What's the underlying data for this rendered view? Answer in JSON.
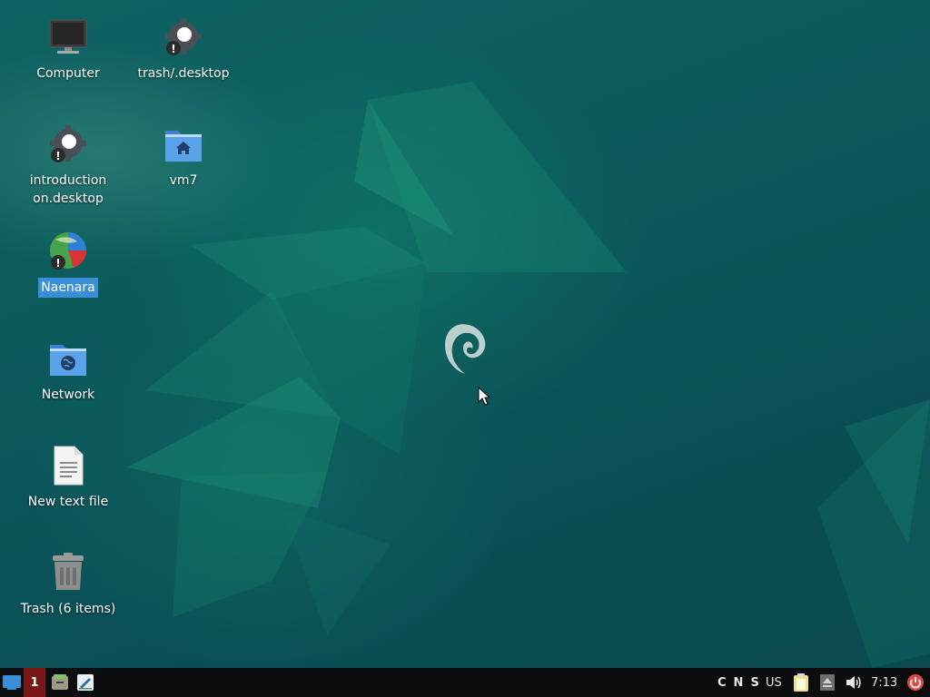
{
  "desktop": {
    "icons": [
      {
        "id": "computer",
        "label": "Computer",
        "icon": "monitor-icon"
      },
      {
        "id": "trash-desktop",
        "label": "trash∕.desktop",
        "icon": "gear-warning-icon"
      },
      {
        "id": "introduction",
        "label": "introduction\non.desktop",
        "icon": "gear-warning-icon"
      },
      {
        "id": "vm7",
        "label": "vm7",
        "icon": "home-folder-icon"
      },
      {
        "id": "naenara",
        "label": "Naenara",
        "icon": "globe-browser-icon",
        "selected": true
      },
      {
        "id": "network",
        "label": "Network",
        "icon": "network-folder-icon"
      },
      {
        "id": "new-text-file",
        "label": "New text file",
        "icon": "text-file-icon"
      },
      {
        "id": "trash",
        "label": "Trash (6 items)",
        "icon": "trash-can-icon"
      }
    ]
  },
  "taskbar": {
    "workspace": "1",
    "keyboard_indicators": [
      "C",
      "N",
      "S"
    ],
    "layout": "US",
    "clock": "7:13",
    "icons": [
      "show-desktop-icon",
      "file-manager-icon",
      "text-editor-icon",
      "clipboard-icon",
      "eject-icon",
      "volume-icon",
      "power-icon"
    ]
  },
  "colors": {
    "taskbar_bg": "#0b0d0e",
    "workspace_active": "#7a1818",
    "selection": "#3b8fd9",
    "power": "#e0454a"
  }
}
